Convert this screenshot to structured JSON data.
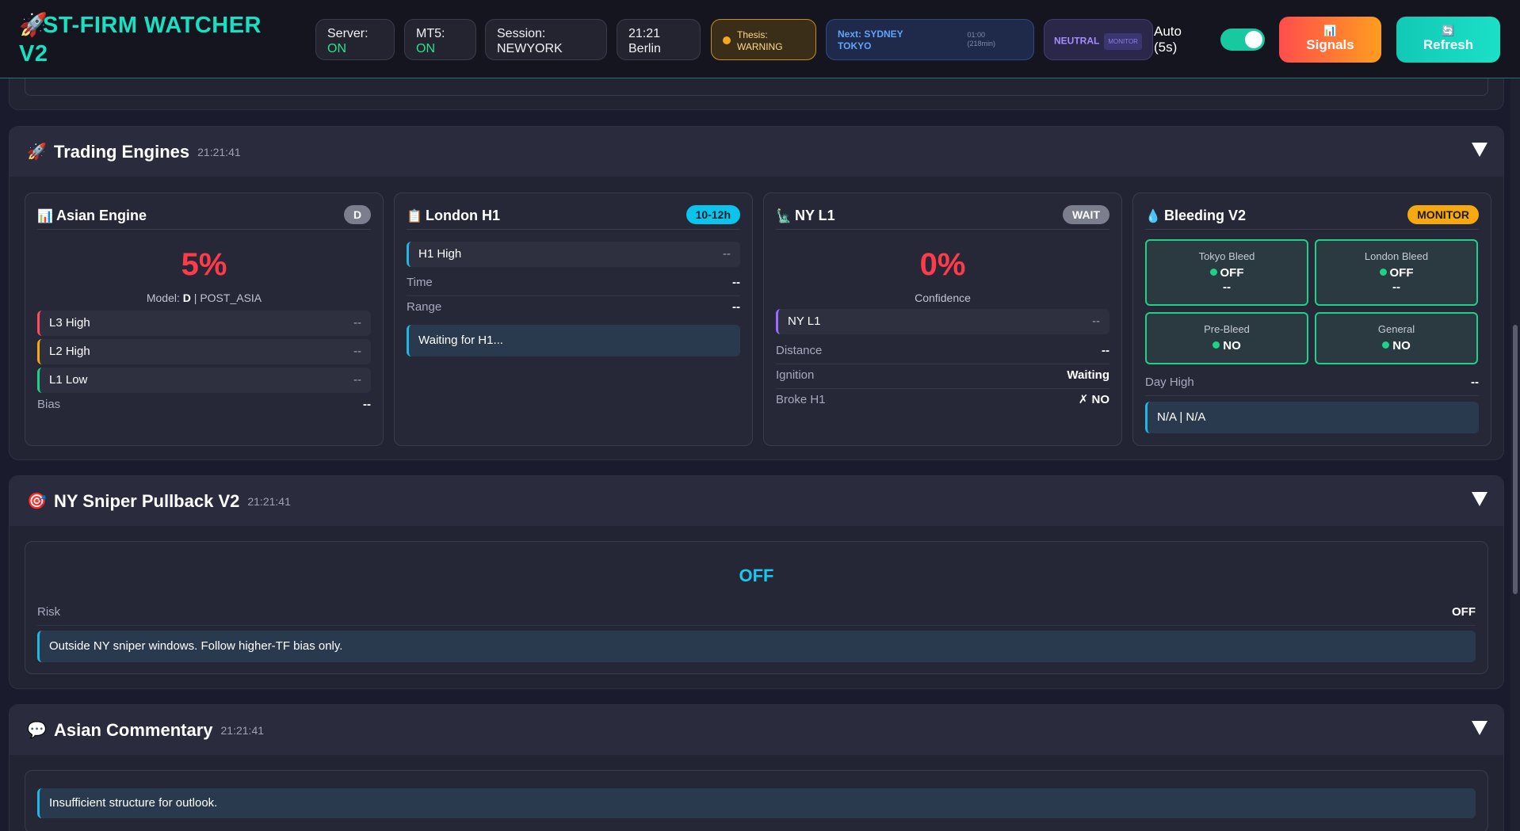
{
  "header": {
    "title": "ST-FIRM WATCHER V2",
    "server_label": "Server:",
    "server_value": "ON",
    "mt5_label": "MT5:",
    "mt5_value": "ON",
    "session_label": "Session:",
    "session_value": "NEWYORK",
    "time_value": "21:21",
    "time_zone": "Berlin",
    "thesis_label": "Thesis:",
    "thesis_value": "WARNING",
    "next_label": "Next: SYDNEY",
    "next_value": "TOKYO",
    "next_time": "01:00",
    "next_minutes": "(218min)",
    "bias_label": "NEUTRAL",
    "bias_tag": "MONITOR",
    "auto_label": "Auto",
    "auto_interval": "(5s)",
    "auto_enabled": true,
    "signals_label": "Signals",
    "refresh_label": "Refresh"
  },
  "trading_engines": {
    "title": "Trading Engines",
    "timestamp": "21:21:41",
    "asian": {
      "title": "Asian Engine",
      "badge": "D",
      "percent": "5%",
      "model_prefix": "Model:",
      "model_value": "D",
      "model_suffix": "| POST_ASIA",
      "levels": [
        {
          "label": "L3 High",
          "value": "--",
          "color": "#ff4d5a"
        },
        {
          "label": "L2 High",
          "value": "--",
          "color": "#f5a80f"
        },
        {
          "label": "L1 Low",
          "value": "--",
          "color": "#1ed189"
        }
      ],
      "bias_label": "Bias",
      "bias_value": "--"
    },
    "london": {
      "title": "London H1",
      "badge": "10-12h",
      "level_label": "H1 High",
      "level_value": "--",
      "time_label": "Time",
      "time_value": "--",
      "range_label": "Range",
      "range_value": "--",
      "status": "Waiting for H1..."
    },
    "ny": {
      "title": "NY L1",
      "badge": "WAIT",
      "percent": "0%",
      "confidence_label": "Confidence",
      "level_label": "NY L1",
      "level_value": "--",
      "distance_label": "Distance",
      "distance_value": "--",
      "ignition_label": "Ignition",
      "ignition_value": "Waiting",
      "broke_label": "Broke H1",
      "broke_value": "✗ NO"
    },
    "bleeding": {
      "title": "Bleeding V2",
      "badge": "MONITOR",
      "tiles": [
        {
          "label": "Tokyo Bleed",
          "state": "OFF",
          "extra": "--"
        },
        {
          "label": "London Bleed",
          "state": "OFF",
          "extra": "--"
        },
        {
          "label": "Pre-Bleed",
          "state": "NO",
          "extra": ""
        },
        {
          "label": "General",
          "state": "NO",
          "extra": ""
        }
      ],
      "day_high_label": "Day High",
      "day_high_value": "--",
      "status": "N/A | N/A"
    }
  },
  "ny_sniper": {
    "title": "NY Sniper Pullback V2",
    "timestamp": "21:21:41",
    "state": "OFF",
    "risk_label": "Risk",
    "risk_value": "OFF",
    "message": "Outside NY sniper windows. Follow higher-TF bias only."
  },
  "asian_commentary": {
    "title": "Asian Commentary",
    "timestamp": "21:21:41",
    "message": "Insufficient structure for outlook."
  },
  "colors": {
    "accent": "#19e0c0",
    "on": "#2ee089",
    "danger": "#ff3b4a",
    "warning": "#f5a80f",
    "info": "#0cc3ec"
  }
}
